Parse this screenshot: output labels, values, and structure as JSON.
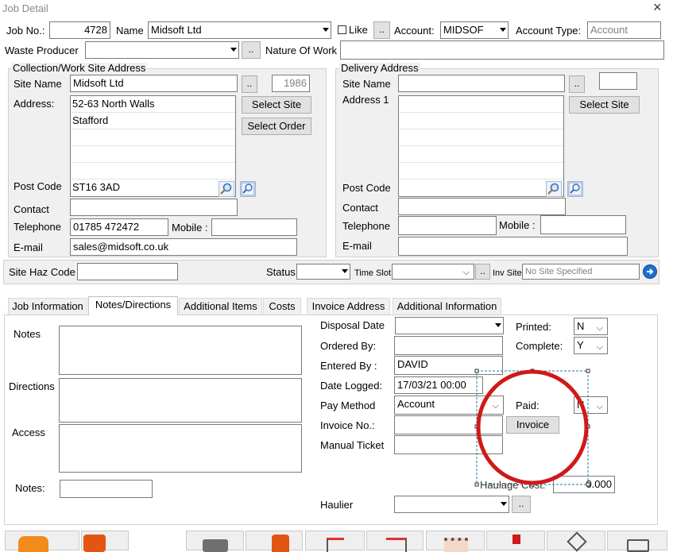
{
  "window": {
    "title": "Job Detail",
    "close_glyph": "×"
  },
  "header": {
    "job_no_label": "Job No.:",
    "job_no_value": "4728",
    "name_label": "Name",
    "name_value": "Midsoft Ltd",
    "like_label": "Like",
    "like_checked": false,
    "account_label": "Account:",
    "account_value": "MIDSOF",
    "account_type_label": "Account Type:",
    "account_type_placeholder": "Account",
    "waste_producer_label": "Waste Producer",
    "waste_producer_value": "",
    "nature_of_work_label": "Nature Of Work",
    "nature_of_work_value": "",
    "dots_label": ".."
  },
  "collection": {
    "group_title": "Collection/Work Site Address",
    "site_name_label": "Site Name",
    "site_name_value": "Midsoft Ltd",
    "site_id": "1986",
    "address_label": "Address:",
    "address_lines": [
      "52-63 North Walls",
      "Stafford",
      "",
      "",
      ""
    ],
    "select_site_label": "Select Site",
    "select_order_label": "Select Order",
    "post_code_label": "Post Code",
    "post_code_value": "ST16 3AD",
    "contact_label": "Contact",
    "contact_value": "",
    "telephone_label": "Telephone",
    "telephone_value": "01785 472472",
    "mobile_label": "Mobile :",
    "mobile_value": "",
    "email_label": "E-mail",
    "email_value": "sales@midsoft.co.uk"
  },
  "delivery": {
    "group_title": "Delivery Address",
    "site_name_label": "Site Name",
    "site_name_value": "",
    "site_id": "",
    "address_label": "Address 1",
    "select_site_label": "Select Site",
    "post_code_label": "Post Code",
    "post_code_value": "",
    "contact_label": "Contact",
    "contact_value": "",
    "telephone_label": "Telephone",
    "telephone_value": "",
    "mobile_label": "Mobile :",
    "mobile_value": "",
    "email_label": "E-mail",
    "email_value": ""
  },
  "status_row": {
    "site_haz_label": "Site Haz Code",
    "site_haz_value": "",
    "status_label": "Status",
    "status_value": "",
    "time_slot_label": "Time Slot",
    "time_slot_value": "",
    "inv_site_label": "Inv Site",
    "inv_site_value": "No Site Specified"
  },
  "tabs": [
    {
      "label": "Job Information"
    },
    {
      "label": "Notes/Directions"
    },
    {
      "label": "Additional Items"
    },
    {
      "label": "Costs"
    },
    {
      "label": "Invoice Address"
    },
    {
      "label": "Additional Information"
    }
  ],
  "notes_tab": {
    "notes_label": "Notes",
    "directions_label": "Directions",
    "access_label": "Access",
    "short_notes_label": "Notes:",
    "short_notes_value": "",
    "disposal_date_label": "Disposal Date",
    "disposal_date_value": "",
    "ordered_by_label": "Ordered By:",
    "ordered_by_value": "",
    "entered_by_label": "Entered By :",
    "entered_by_value": "DAVID",
    "date_logged_label": "Date Logged:",
    "date_logged_value": "17/03/21 00:00",
    "pay_method_label": "Pay Method",
    "pay_method_value": "Account",
    "invoice_no_label": "Invoice  No.:",
    "invoice_no_value": "",
    "manual_ticket_label": "Manual Ticket",
    "manual_ticket_value": "",
    "printed_label": "Printed:",
    "printed_value": "N",
    "complete_label": "Complete:",
    "complete_value": "Y",
    "paid_label": "Paid:",
    "paid_value": "N",
    "invoice_button_label": "Invoice",
    "haulage_cost_label": "Haulage Cost:",
    "haulage_cost_value": "0.000",
    "haulier_label": "Haulier",
    "haulier_value": ""
  },
  "colors": {
    "panel_bg": "#f0f0f0",
    "annotation_red": "#d01919",
    "selection_dash": "#2a7a9a",
    "go_button_blue": "#1c6fd1"
  },
  "icons": {
    "lookup": "magnifier-icon",
    "go": "arrow-right-circle-icon"
  }
}
